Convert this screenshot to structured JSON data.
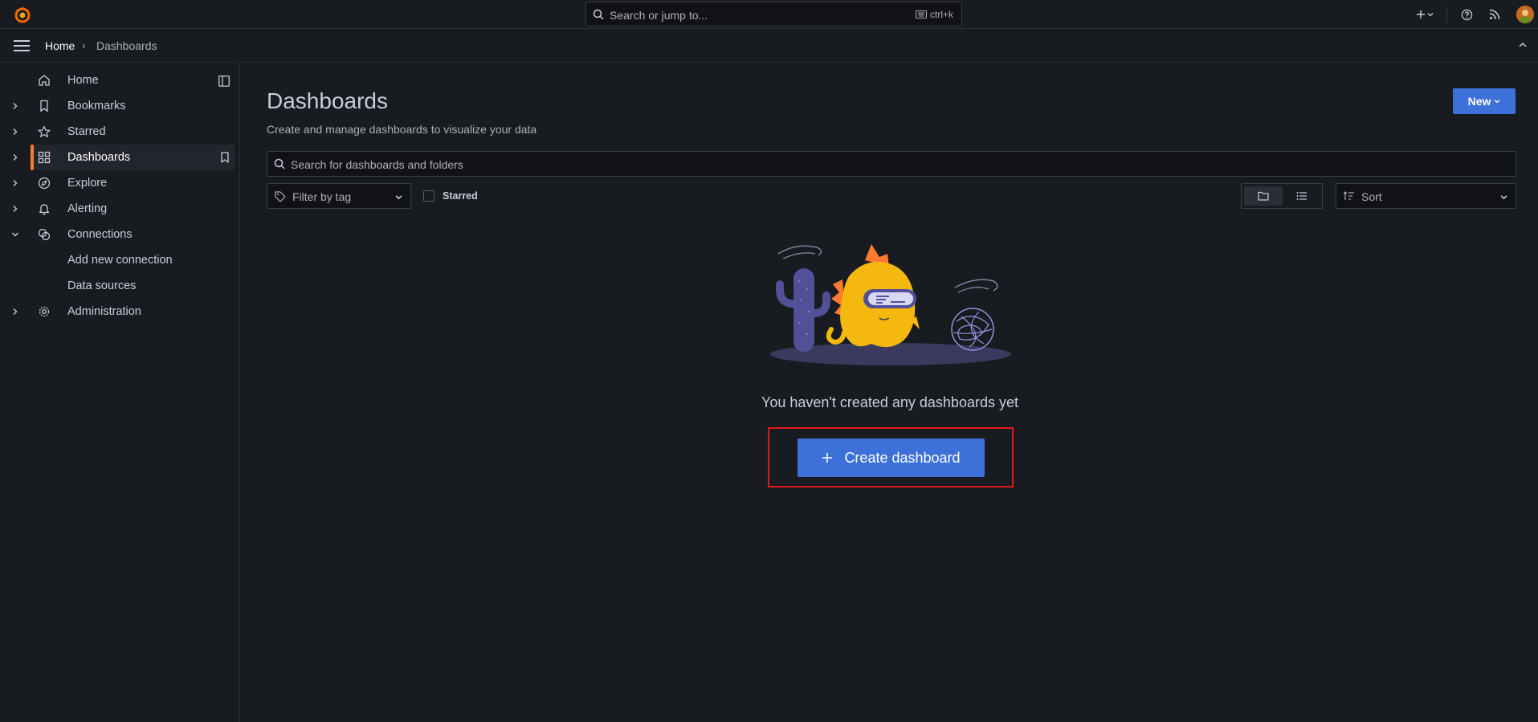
{
  "topbar": {
    "search_placeholder": "Search or jump to...",
    "shortcut": "ctrl+k"
  },
  "breadcrumb": {
    "home": "Home",
    "separator": "›",
    "current": "Dashboards"
  },
  "sidebar": {
    "items": [
      {
        "label": "Home",
        "icon": "home-icon"
      },
      {
        "label": "Bookmarks",
        "icon": "bookmark-icon"
      },
      {
        "label": "Starred",
        "icon": "star-icon"
      },
      {
        "label": "Dashboards",
        "icon": "dashboards-icon"
      },
      {
        "label": "Explore",
        "icon": "compass-icon"
      },
      {
        "label": "Alerting",
        "icon": "bell-icon"
      },
      {
        "label": "Connections",
        "icon": "connections-icon"
      },
      {
        "label": "Administration",
        "icon": "gear-icon"
      }
    ],
    "connections_children": [
      "Add new connection",
      "Data sources"
    ]
  },
  "main": {
    "title": "Dashboards",
    "subtitle": "Create and manage dashboards to visualize your data",
    "new_label": "New",
    "search_placeholder": "Search for dashboards and folders",
    "filter_tag_placeholder": "Filter by tag",
    "starred_label": "Starred",
    "sort_placeholder": "Sort",
    "empty_text": "You haven't created any dashboards yet",
    "create_label": "Create dashboard"
  },
  "colors": {
    "accent": "#3d71d9",
    "active_indicator": "#ff7a2e",
    "highlight": "#e0191a",
    "background": "#181b1f"
  }
}
